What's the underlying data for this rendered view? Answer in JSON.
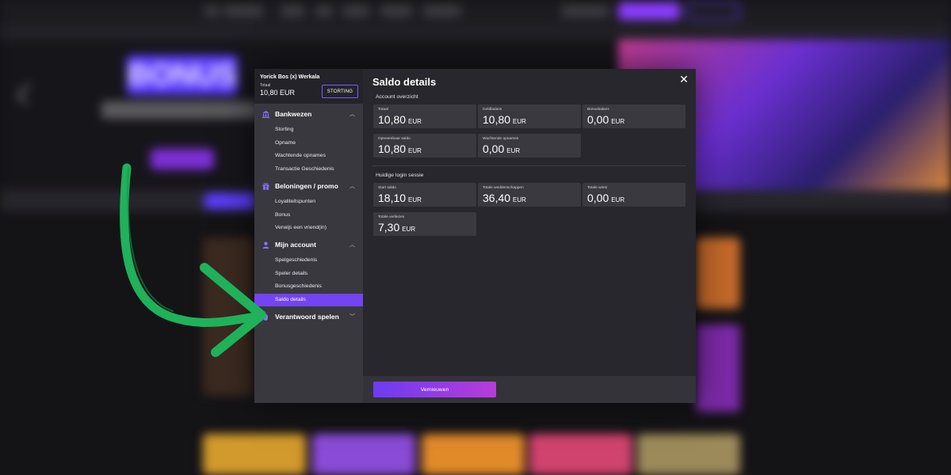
{
  "account": {
    "name": "Yorick Bos (x) Werkala",
    "total_label": "Totaal",
    "total_value": "10,80 EUR",
    "deposit_button": "STORTING"
  },
  "sidebar": {
    "sections": [
      {
        "title": "Bankwezen",
        "icon": "bank-icon",
        "chevron": "up",
        "items": [
          "Storting",
          "Opname",
          "Wachtende opnames",
          "Transactie Geschiedenis"
        ]
      },
      {
        "title": "Beloningen / promo",
        "icon": "gift-icon",
        "chevron": "up",
        "items": [
          "Loyaliteitspunten",
          "Bonus",
          "Verwijs een vriend(in)"
        ]
      },
      {
        "title": "Mijn account",
        "icon": "user-icon",
        "chevron": "up",
        "items": [
          "Spelgeschiedenis",
          "Speler details",
          "Bonusgeschiedenis",
          "Saldo details"
        ],
        "active_item": "Saldo details"
      },
      {
        "title": "Verantwoord spelen",
        "icon": "hand-icon",
        "chevron": "down",
        "items": []
      }
    ]
  },
  "main": {
    "title": "Saldo details",
    "close_icon": "close-icon",
    "account_overview": {
      "label": "Account overzicht",
      "cards": [
        {
          "label": "Totaal",
          "value": "10,80",
          "currency": "EUR"
        },
        {
          "label": "Geldbalans",
          "value": "10,80",
          "currency": "EUR"
        },
        {
          "label": "Bonusbalans",
          "value": "0,00",
          "currency": "EUR"
        },
        {
          "label": "Opneembaar saldo",
          "value": "10,80",
          "currency": "EUR"
        },
        {
          "label": "Wachtende opnames",
          "value": "0,00",
          "currency": "EUR"
        }
      ]
    },
    "login_session": {
      "label": "Huidige login sessie",
      "cards": [
        {
          "label": "Start saldo",
          "value": "18,10",
          "currency": "EUR"
        },
        {
          "label": "Totale weddenschappen",
          "value": "36,40",
          "currency": "EUR"
        },
        {
          "label": "Totale winst",
          "value": "0,00",
          "currency": "EUR"
        },
        {
          "label": "Totale verliezen",
          "value": "7,30",
          "currency": "EUR"
        }
      ]
    },
    "refresh_button": "Vernieuwen"
  },
  "background": {
    "hero_text": "BONUS",
    "colors": {
      "accent": "#7444f2",
      "arrow": "#1fb25a"
    }
  }
}
